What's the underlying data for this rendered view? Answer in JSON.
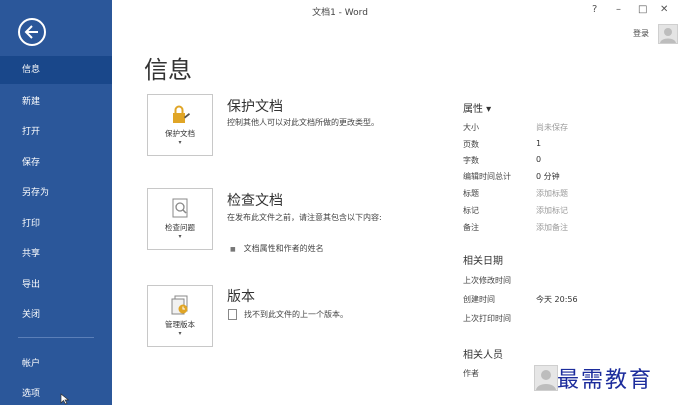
{
  "window": {
    "title": "文档1 - Word",
    "help": "?",
    "minimize": "–",
    "restore": "□",
    "close": "✕"
  },
  "account": {
    "login": "登录"
  },
  "nav": {
    "items": [
      {
        "label": "信息",
        "selected": true
      },
      {
        "label": "新建"
      },
      {
        "label": "打开"
      },
      {
        "label": "保存"
      },
      {
        "label": "另存为"
      },
      {
        "label": "打印"
      },
      {
        "label": "共享"
      },
      {
        "label": "导出"
      },
      {
        "label": "关闭"
      },
      {
        "label": "帐户"
      },
      {
        "label": "选项"
      }
    ]
  },
  "page": {
    "title": "信息"
  },
  "cards": [
    {
      "button": "保护文档",
      "title": "保护文档",
      "desc": "控制其他人可以对此文档所做的更改类型。",
      "icon": "lock-icon"
    },
    {
      "button": "检查问题",
      "title": "检查文档",
      "desc": "在发布此文件之前，请注意其包含以下内容:",
      "bullet": "文档属性和作者的姓名",
      "icon": "inspect-icon"
    },
    {
      "button": "管理版本",
      "title": "版本",
      "desc": "找不到此文件的上一个版本。",
      "icon": "versions-icon"
    }
  ],
  "properties": {
    "heading": "属性 ▾",
    "rows": [
      {
        "label": "大小",
        "value": "尚未保存",
        "muted": true
      },
      {
        "label": "页数",
        "value": "1"
      },
      {
        "label": "字数",
        "value": "0"
      },
      {
        "label": "编辑时间总计",
        "value": "0 分钟"
      },
      {
        "label": "标题",
        "value": "添加标题",
        "muted": true
      },
      {
        "label": "标记",
        "value": "添加标记",
        "muted": true
      },
      {
        "label": "备注",
        "value": "添加备注",
        "muted": true
      }
    ]
  },
  "dates": {
    "heading": "相关日期",
    "rows": [
      {
        "label": "上次修改时间",
        "value": ""
      },
      {
        "label": "创建时间",
        "value": "今天 20:56"
      },
      {
        "label": "上次打印时间",
        "value": ""
      }
    ]
  },
  "people": {
    "heading": "相关人员",
    "author_label": "作者"
  },
  "watermark": "最需教育",
  "colors": {
    "sidebar": "#2b579a",
    "selected": "#19478a"
  }
}
